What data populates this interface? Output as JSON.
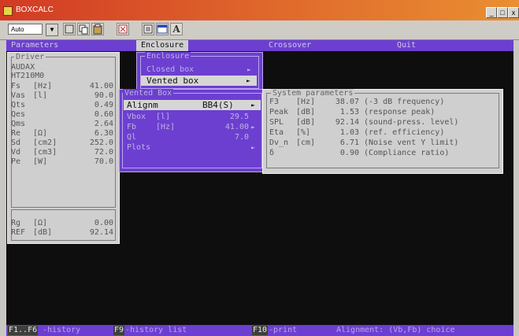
{
  "window": {
    "title": "BOXCALC",
    "minimize": "_",
    "maximize": "□",
    "close": "x"
  },
  "toolbar": {
    "font_select": "Auto",
    "dropdown_glyph": "▼",
    "font_glyph": "A"
  },
  "menubar": {
    "items": [
      "Parameters",
      "Enclosure",
      "Crossover",
      "Quit"
    ]
  },
  "driver": {
    "title": "Driver",
    "brand": "AUDAX",
    "model": "HT210M0",
    "params": [
      {
        "name": "Fs",
        "unit": "[Hz]",
        "value": "41.00"
      },
      {
        "name": "Vas",
        "unit": "[l]",
        "value": "90.0"
      },
      {
        "name": "Qts",
        "unit": "",
        "value": "0.49"
      },
      {
        "name": "Qes",
        "unit": "",
        "value": "0.60"
      },
      {
        "name": "Qms",
        "unit": "",
        "value": "2.64"
      },
      {
        "name": "Re",
        "unit": "[Ω]",
        "value": "6.30"
      },
      {
        "name": "Sd",
        "unit": "[cm2]",
        "value": "252.0"
      },
      {
        "name": "Vd",
        "unit": "[cm3]",
        "value": "72.0"
      },
      {
        "name": "Pe",
        "unit": "[W]",
        "value": "70.0"
      }
    ],
    "extra": [
      {
        "name": "Rg",
        "unit": "[Ω]",
        "value": "0.00"
      },
      {
        "name": "REF",
        "unit": "[dB]",
        "value": "92.14"
      }
    ]
  },
  "enclosure_menu": {
    "title": "Enclosure",
    "items": [
      {
        "label": "Closed box",
        "arrow": "►"
      },
      {
        "label": "Vented box",
        "arrow": "►"
      }
    ]
  },
  "vented_menu": {
    "title": "Vented Box",
    "items": [
      {
        "label": "Alignm",
        "value": "BB4(S)",
        "arrow": "►"
      },
      {
        "label": "Vbox",
        "unit": "[l]",
        "value": "29.5",
        "arrow": ""
      },
      {
        "label": "Fb",
        "unit": "[Hz]",
        "value": "41.00",
        "arrow": "►"
      },
      {
        "label": "Ql",
        "unit": "",
        "value": "7.0",
        "arrow": ""
      },
      {
        "label": "Plots",
        "unit": "",
        "value": "",
        "arrow": "►"
      }
    ]
  },
  "system_params": {
    "title": "System parameters",
    "rows": [
      {
        "name": "F3",
        "unit": "[Hz]",
        "value": "38.07",
        "desc": "(-3 dB frequency)"
      },
      {
        "name": "Peak",
        "unit": "[dB]",
        "value": "1.53",
        "desc": "(response peak)"
      },
      {
        "name": "SPL",
        "unit": "[dB]",
        "value": "92.14",
        "desc": "(sound-press. level)"
      },
      {
        "name": "Eta",
        "unit": "[%]",
        "value": "1.03",
        "desc": "(ref. efficiency)"
      },
      {
        "name": "Dv_n",
        "unit": "[cm]",
        "value": "6.71",
        "desc": "(Noise vent Y limit)"
      },
      {
        "name": "δ",
        "unit": "",
        "value": "0.90",
        "desc": "(Compliance ratio)"
      }
    ]
  },
  "statusbar": {
    "k1": "F1..F6",
    "d1": "-history",
    "k2": "F9",
    "d2": "-history list",
    "k3": "F10",
    "d3": "-print",
    "hint": "Alignment: (Vb,Fb) choice"
  }
}
